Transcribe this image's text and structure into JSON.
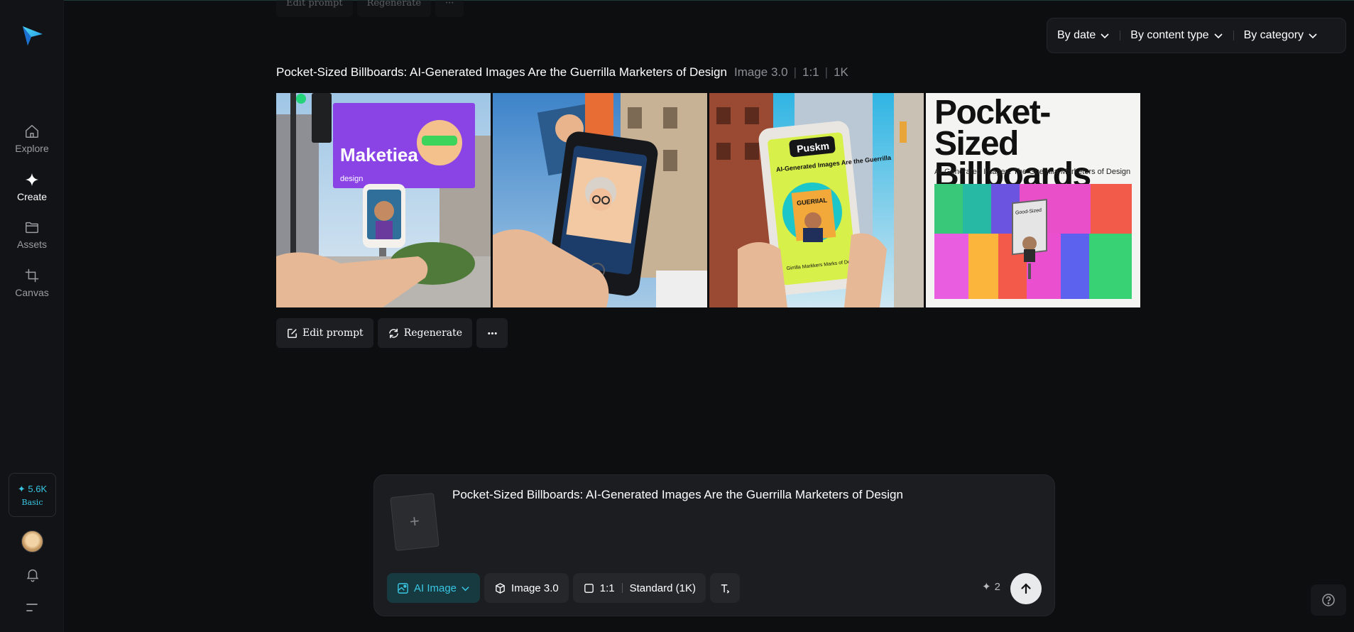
{
  "sidebar": {
    "items": [
      {
        "label": "Explore",
        "icon": "home-icon",
        "active": false
      },
      {
        "label": "Create",
        "icon": "sparkle-icon",
        "active": true
      },
      {
        "label": "Assets",
        "icon": "folder-icon",
        "active": false
      },
      {
        "label": "Canvas",
        "icon": "crop-icon",
        "active": false
      }
    ],
    "credits": {
      "amount": "✦ 5.6K",
      "plan": "Basic"
    }
  },
  "filters": {
    "by_date": "By date",
    "by_content_type": "By content type",
    "by_category": "By category"
  },
  "ghost_toolbar": {
    "edit_prompt": "Edit prompt",
    "regenerate": "Regenerate"
  },
  "result": {
    "prompt": "Pocket-Sized Billboards: AI-Generated Images Are the Guerrilla Marketers of Design",
    "model": "Image 3.0",
    "ratio": "1:1",
    "resolution": "1K",
    "images": [
      {
        "text": [
          "Maketiea",
          "design"
        ]
      },
      {
        "text": []
      },
      {
        "text": [
          "Puskm",
          "AI-Generated Images Are the Guerrilla",
          "GUERIIAL",
          "Girrilla Markkers Marks of Design."
        ]
      },
      {
        "text": [
          "Pocket-Sized Billboards",
          "AI-Generated Images: The Guerrilla Marketers of Design",
          "Good-Sized"
        ]
      }
    ],
    "actions": {
      "edit_prompt": "Edit prompt",
      "regenerate": "Regenerate"
    }
  },
  "composer": {
    "prompt_value": "Pocket-Sized Billboards: AI-Generated Images Are the Guerrilla Marketers of Design",
    "mode": "AI Image",
    "model": "Image 3.0",
    "ratio": "1:1",
    "quality": "Standard (1K)",
    "cost": "2"
  },
  "colors": {
    "accent": "#38c6e3",
    "background": "#0d0e10",
    "panel": "#1b1d20"
  }
}
